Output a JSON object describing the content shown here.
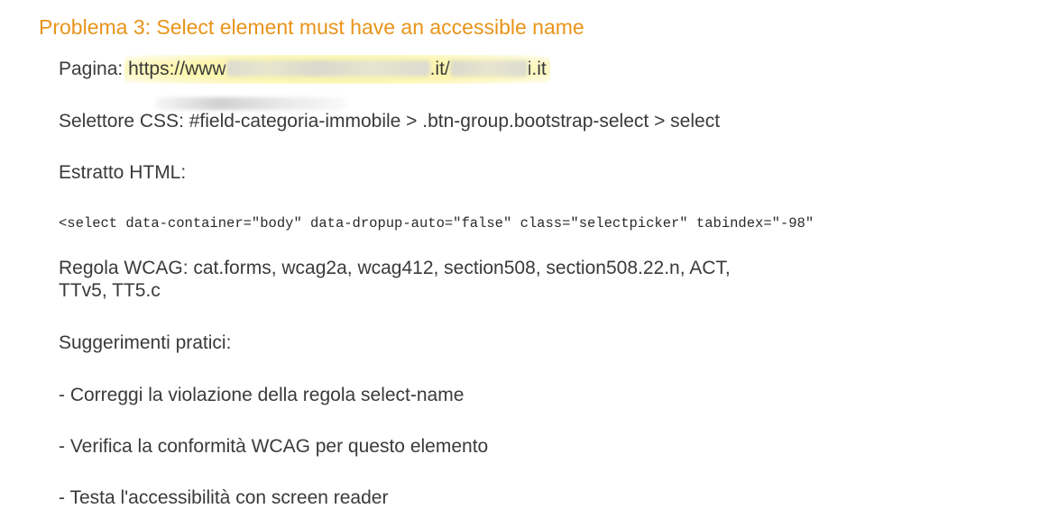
{
  "title": "Problema 3: Select element must have an accessible name",
  "page": {
    "label": "Pagina: ",
    "url_prefix": "https://www",
    "url_middle": ".it/",
    "url_suffix": "i.it"
  },
  "selector": {
    "text": "Selettore CSS: #field-categoria-immobile > .btn-group.bootstrap-select > select"
  },
  "html_extract": {
    "label": "Estratto HTML:",
    "code": "<select data-container=\"body\" data-dropup-auto=\"false\" class=\"selectpicker\" tabindex=\"-98\""
  },
  "wcag": {
    "line1": "Regola WCAG: cat.forms, wcag2a, wcag412, section508, section508.22.n, ACT,",
    "line2": "TTv5, TT5.c"
  },
  "suggestions": {
    "label": "Suggerimenti pratici:",
    "items": [
      "- Correggi la violazione della regola select-name",
      "- Verifica la conformità WCAG per questo elemento",
      "- Testa l'accessibilità con screen reader"
    ]
  }
}
